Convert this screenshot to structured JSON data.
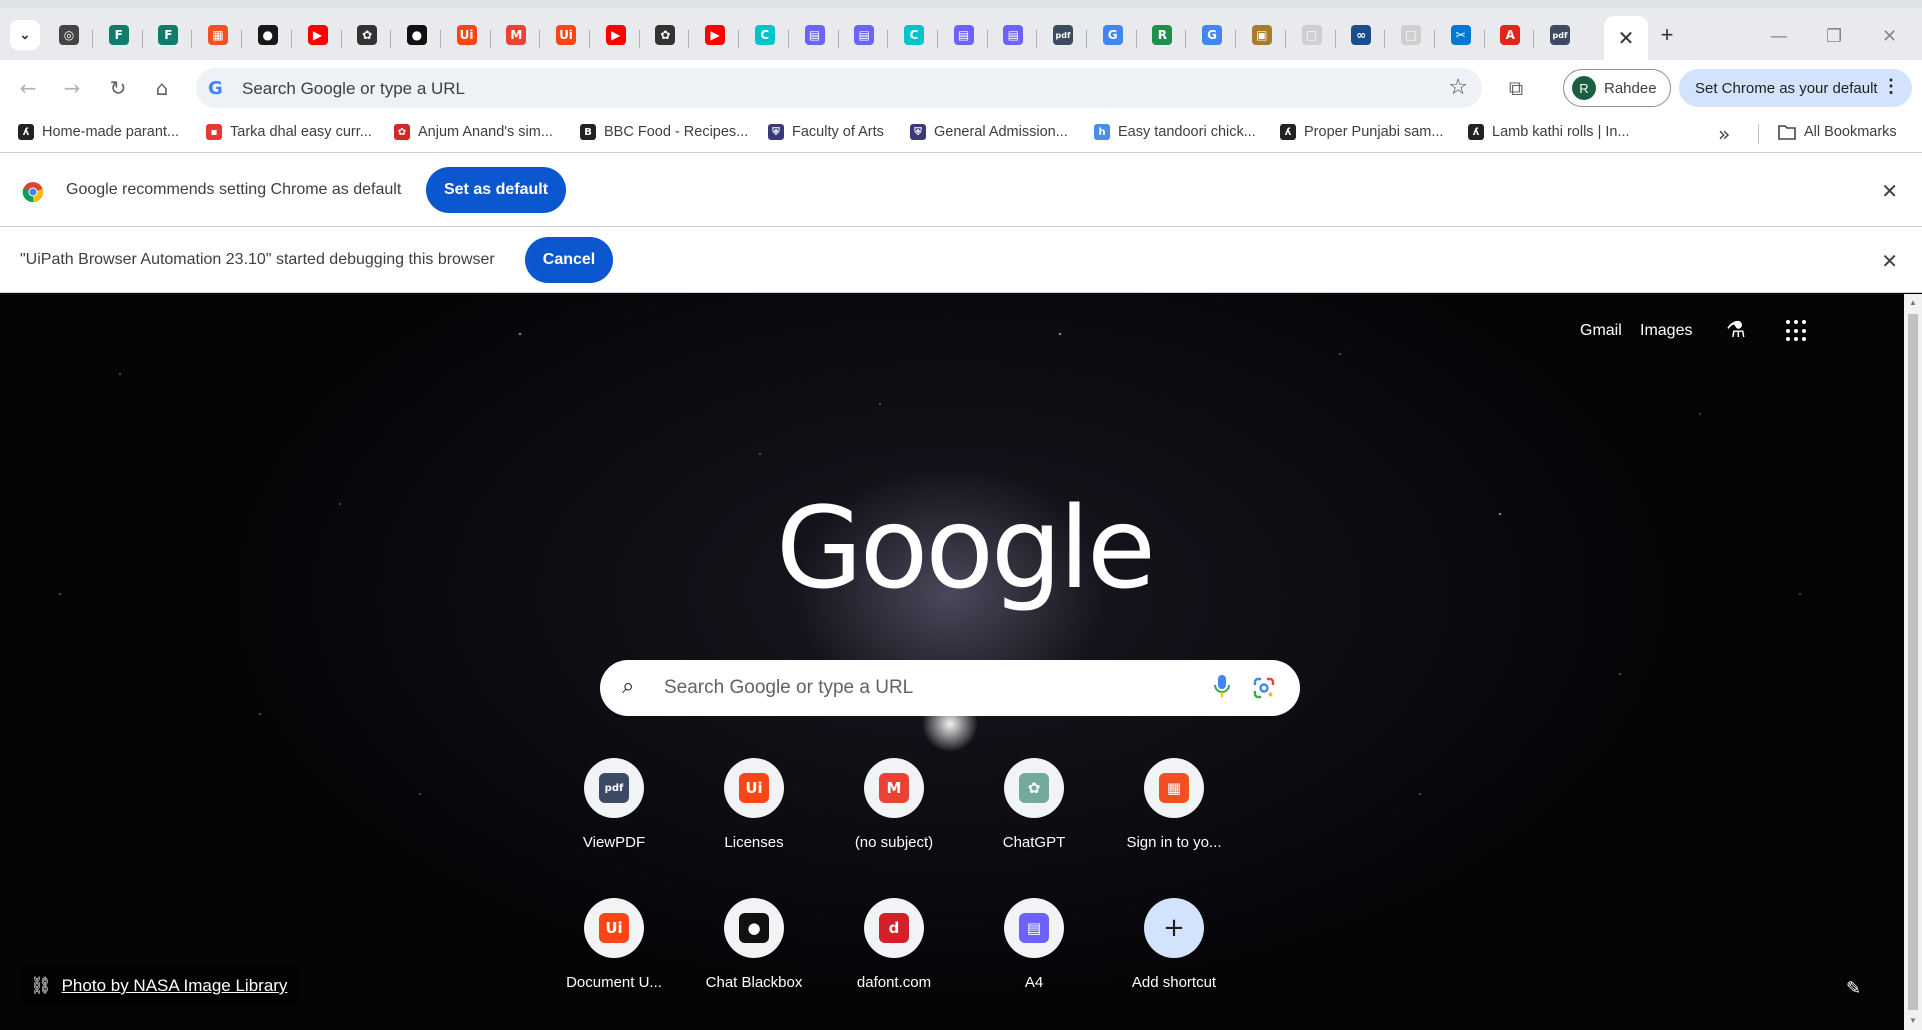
{
  "tabs": {
    "favicons": [
      {
        "name": "chrome-tab",
        "glyph": "◎",
        "color": "#444"
      },
      {
        "name": "forms-tab",
        "glyph": "F",
        "color": "#107c6e"
      },
      {
        "name": "forms-tab",
        "glyph": "F",
        "color": "#107c6e"
      },
      {
        "name": "microsoft-tab",
        "glyph": "▦",
        "color": "#f25022"
      },
      {
        "name": "github-tab",
        "glyph": "●",
        "color": "#181717"
      },
      {
        "name": "youtube-tab",
        "glyph": "▶",
        "color": "#ff0000"
      },
      {
        "name": "chatgpt-tab",
        "glyph": "✿",
        "color": "#333"
      },
      {
        "name": "blackbox-tab",
        "glyph": "●",
        "color": "#111"
      },
      {
        "name": "uipath-tab",
        "glyph": "Ui",
        "color": "#fa4616"
      },
      {
        "name": "gmail-tab",
        "glyph": "M",
        "color": "#ea4335"
      },
      {
        "name": "uipath-tab",
        "glyph": "Ui",
        "color": "#fa4616"
      },
      {
        "name": "youtube-tab",
        "glyph": "▶",
        "color": "#ff0000"
      },
      {
        "name": "chatgpt-tab",
        "glyph": "✿",
        "color": "#333"
      },
      {
        "name": "youtube-tab",
        "glyph": "▶",
        "color": "#ff0000"
      },
      {
        "name": "canva-tab",
        "glyph": "C",
        "color": "#00c4cc"
      },
      {
        "name": "printer-tab",
        "glyph": "▤",
        "color": "#6c63ff"
      },
      {
        "name": "printer-tab",
        "glyph": "▤",
        "color": "#6c63ff"
      },
      {
        "name": "canva-tab",
        "glyph": "C",
        "color": "#00c4cc"
      },
      {
        "name": "printer-tab",
        "glyph": "▤",
        "color": "#6c63ff"
      },
      {
        "name": "printer-tab",
        "glyph": "▤",
        "color": "#6c63ff"
      },
      {
        "name": "pdf-tab",
        "glyph": "pdf",
        "color": "#3d4a63"
      },
      {
        "name": "google-tab",
        "glyph": "G",
        "color": "#4285f4"
      },
      {
        "name": "r-tab",
        "glyph": "R",
        "color": "#1f8f4e"
      },
      {
        "name": "google-tab",
        "glyph": "G",
        "color": "#4285f4"
      },
      {
        "name": "app-tab",
        "glyph": "▣",
        "color": "#a77d2b"
      },
      {
        "name": "blank-tab",
        "glyph": "□",
        "color": "#cfcfcf"
      },
      {
        "name": "infinity-tab",
        "glyph": "∞",
        "color": "#1a4e8a"
      },
      {
        "name": "blank-tab",
        "glyph": "□",
        "color": "#cfcfcf"
      },
      {
        "name": "tool-tab",
        "glyph": "✂",
        "color": "#0078d4"
      },
      {
        "name": "adobe-tab",
        "glyph": "A",
        "color": "#e1251b"
      },
      {
        "name": "pdf-tab",
        "glyph": "pdf",
        "color": "#3d4a63"
      }
    ],
    "active_close": "✕",
    "new_tab": "+"
  },
  "window": {
    "minimize": "—",
    "restore": "❐",
    "close": "✕"
  },
  "toolbar": {
    "back": "←",
    "forward": "→",
    "reload": "↻",
    "home": "⌂",
    "omnibox_placeholder": "Search Google or type a URL",
    "star": "☆",
    "extensions": "⧉",
    "profile_initial": "R",
    "profile_name": "Rahdee",
    "set_default_label": "Set Chrome as your default",
    "more": "⋮"
  },
  "bookmarks": [
    {
      "label": "Home-made parant...",
      "icon": "ʎ",
      "color": "#222"
    },
    {
      "label": "Tarka dhal easy curr...",
      "icon": "▪",
      "color": "#e53935"
    },
    {
      "label": "Anjum Anand's sim...",
      "icon": "✿",
      "color": "#cf2a27"
    },
    {
      "label": "BBC Food - Recipes...",
      "icon": "B",
      "color": "#222"
    },
    {
      "label": "Faculty of Arts",
      "icon": "⛨",
      "color": "#3a3a7a"
    },
    {
      "label": "General Admission...",
      "icon": "⛨",
      "color": "#3a3a7a"
    },
    {
      "label": "Easy tandoori chick...",
      "icon": "h",
      "color": "#4a90e2"
    },
    {
      "label": "Proper Punjabi sam...",
      "icon": "ʎ",
      "color": "#222"
    },
    {
      "label": "Lamb kathi rolls | In...",
      "icon": "ʎ",
      "color": "#222"
    }
  ],
  "bookmarks_overflow": "»",
  "all_bookmarks": "All Bookmarks",
  "infobar_default": {
    "text": "Google recommends setting Chrome as default",
    "button": "Set as default",
    "close": "✕"
  },
  "infobar_debug": {
    "text": "\"UiPath Browser Automation 23.10\" started debugging this browser",
    "button": "Cancel",
    "close": "✕"
  },
  "ntp": {
    "gmail": "Gmail",
    "images": "Images",
    "logo": "Google",
    "search_placeholder": "Search Google or type a URL",
    "shortcuts": [
      {
        "label": "ViewPDF",
        "glyph": "pdf",
        "color": "#3d4a63"
      },
      {
        "label": "Licenses",
        "glyph": "Ui",
        "color": "#fa4616"
      },
      {
        "label": "(no subject)",
        "glyph": "M",
        "color": "#ea4335"
      },
      {
        "label": "ChatGPT",
        "glyph": "✿",
        "color": "#74aa9c"
      },
      {
        "label": "Sign in to yo...",
        "glyph": "▦",
        "color": "#f25022"
      },
      {
        "label": "Document U...",
        "glyph": "Ui",
        "color": "#fa4616"
      },
      {
        "label": "Chat Blackbox",
        "glyph": "●",
        "color": "#111"
      },
      {
        "label": "dafont.com",
        "glyph": "d",
        "color": "#d42027"
      },
      {
        "label": "A4",
        "glyph": "▤",
        "color": "#6c63ff"
      },
      {
        "label": "Add shortcut",
        "glyph": "+",
        "color": "#1f1f1f"
      }
    ],
    "photo_credit": "Photo by NASA Image Library",
    "customize": "✎"
  },
  "colors": {
    "accent_blue": "#0b57d0",
    "chip_blue": "#d3e3fd",
    "tabstrip": "#e8eaed"
  }
}
